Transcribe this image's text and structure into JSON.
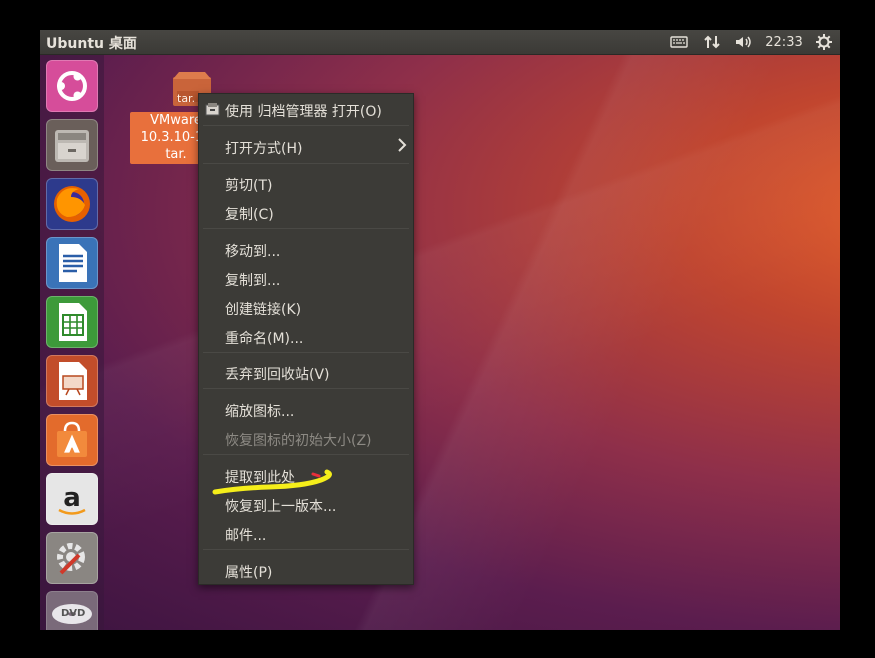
{
  "top_panel": {
    "title": "Ubuntu 桌面",
    "clock": "22:33",
    "tray_icons": [
      "keyboard-icon",
      "network-icon",
      "volume-icon",
      "power-gear-icon"
    ]
  },
  "launcher": {
    "items": [
      "ubuntu-logo-icon",
      "file-cabinet-icon",
      "firefox-icon",
      "writer-icon",
      "calc-icon",
      "impress-icon",
      "software-center-icon",
      "amazon-icon",
      "system-settings-icon",
      "dvd-icon"
    ],
    "dvd_label": "DVD"
  },
  "desktop": {
    "file_icon_badge": "tar.",
    "file_label_lines": [
      "VMware",
      "10.3.10-12",
      "tar."
    ]
  },
  "context_menu": {
    "items": [
      {
        "label": "使用 归档管理器 打开(O)",
        "icon": "archive-manager-icon"
      },
      {
        "label": "打开方式(H)",
        "submenu": true
      },
      {
        "label": "剪切(T)"
      },
      {
        "label": "复制(C)"
      },
      {
        "label": "移动到..."
      },
      {
        "label": "复制到..."
      },
      {
        "label": "创建链接(K)"
      },
      {
        "label": "重命名(M)..."
      },
      {
        "label": "丢弃到回收站(V)"
      },
      {
        "label": "缩放图标..."
      },
      {
        "label": "恢复图标的初始大小(Z)",
        "disabled": true
      },
      {
        "label": "提取到此处",
        "highlighted_annotation": true
      },
      {
        "label": "恢复到上一版本..."
      },
      {
        "label": "邮件..."
      },
      {
        "label": "属性(P)"
      }
    ]
  },
  "annotation_color": "#f5ee1a",
  "colors": {
    "panel": "#3b3a36",
    "menu": "#3c3b37",
    "accent": "#e8703c"
  }
}
